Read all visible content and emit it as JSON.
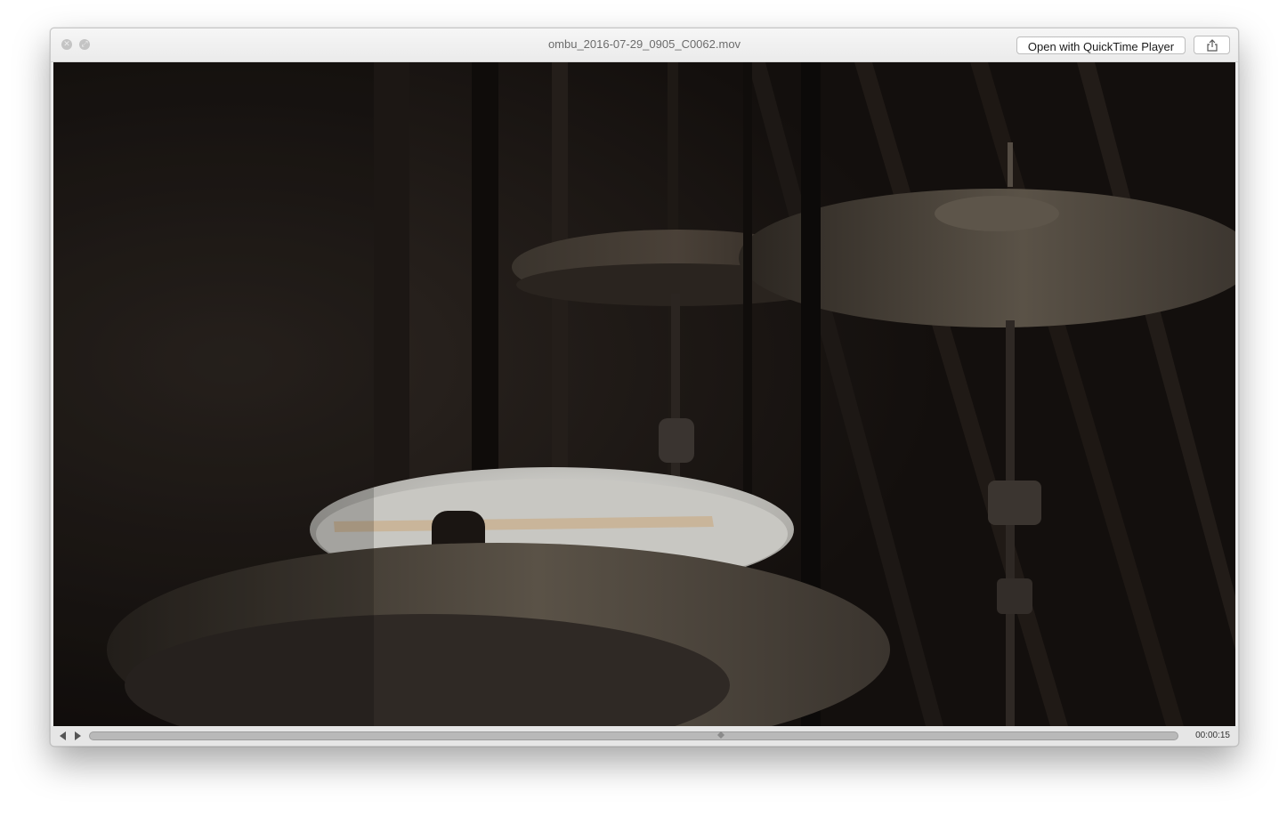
{
  "window": {
    "title": "ombu_2016-07-29_0905_C0062.mov",
    "open_button_label": "Open with QuickTime Player",
    "share_icon": "share-icon",
    "close_icon": "close-icon",
    "fullscreen_icon": "fullscreen-icon"
  },
  "player": {
    "frame_description_icon": "video-frame",
    "back_icon": "skip-back-icon",
    "play_icon": "play-icon",
    "time": "00:00:15",
    "progress": 0.58
  },
  "colors": {
    "accent": "#c4c4c4",
    "scrubber": "#b9b9b9"
  }
}
